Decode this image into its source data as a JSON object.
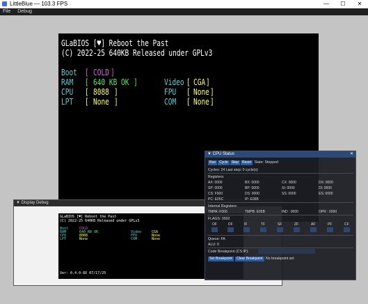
{
  "window": {
    "title": "LittleBlue — 103.3 FPS",
    "minimize": "—",
    "maximize": "☐",
    "close": "✕"
  },
  "menu": {
    "items": [
      "File",
      "Debug"
    ]
  },
  "screen": {
    "line1": "GLaBIOS [♥] Reboot the Past",
    "line2": "(C) 2022-25 640KB Released under GPLv3",
    "boot_label": "Boot",
    "boot_value": "COLD",
    "ram_label": "RAM",
    "ram_value": "640 KB OK",
    "cpu_label": "CPU",
    "cpu_value": "8088",
    "lpt_label": "LPT",
    "lpt_value": "None",
    "video_label": "Video",
    "video_value": "CGA",
    "fpu_label": "FPU",
    "fpu_value": "None",
    "com_label": "COM",
    "com_value": "None",
    "lb": "[",
    "rb": "]"
  },
  "display_debug": {
    "title": "▼ Display Debug",
    "line1": "GLaBIOS [♥] Reboot the Past",
    "line2": "(C) 2022-25 640KB Released under GPLv3",
    "ver": "Ver: 0.4.0-8X 07/17/25"
  },
  "cpu_status": {
    "title": "▼ CPU Status",
    "close": "✕",
    "buttons": [
      "Run",
      "Cycle",
      "Step",
      "Reset"
    ],
    "state": "State: Stopped",
    "cycles": "Cycles: 24 Last step: 0 cycle(s)",
    "registers_label": "Registers:",
    "regs": [
      [
        "AX: 0000",
        "BX: 0000",
        "CX: 0000",
        "DX: 0000"
      ],
      [
        "SP: 0000",
        "BP: 0000",
        "SI: 0000",
        "DI: 0000"
      ],
      [
        "CS: F000",
        "DS: 0000",
        "SS: 0000",
        "ES: 0000"
      ]
    ],
    "pc": "PC: E05C",
    "ip": "IP: E05B",
    "internal_label": "Internal Registers:",
    "internal": [
      "TMPA: F000",
      "TMPB: E05B",
      "IND : 0000",
      "OPR : 0000"
    ],
    "flags_label": "FLAGS: 0002",
    "flags": [
      "OF",
      "DF",
      "IF",
      "TF",
      "SF",
      "ZF",
      "AF",
      "PF",
      "CF"
    ],
    "queue": "Queue: FA",
    "alu": "ALU: 0",
    "bp_label": "Code Breakpoint (CS:IP):",
    "set_bp": "Set Breakpoint",
    "clear_bp": "Clear Breakpoint",
    "bp_status": "No breakpoint set"
  }
}
